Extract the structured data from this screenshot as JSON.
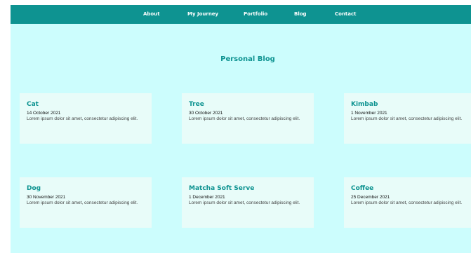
{
  "nav": {
    "items": [
      {
        "label": "About"
      },
      {
        "label": "My Journey"
      },
      {
        "label": "Portfolio"
      },
      {
        "label": "Blog"
      },
      {
        "label": "Contact"
      }
    ]
  },
  "page_title": "Personal Blog",
  "posts": [
    {
      "title": "Cat",
      "date": "14 October 2021",
      "excerpt": "Lorem ipsum dolor sit amet, consectetur adipiscing elit."
    },
    {
      "title": "Tree",
      "date": "30 October 2021",
      "excerpt": "Lorem ipsum dolor sit amet, consectetur adipiscing elit."
    },
    {
      "title": "Kimbab",
      "date": "1 November 2021",
      "excerpt": "Lorem ipsum dolor sit amet, consectetur adipiscing elit."
    },
    {
      "title": "Dog",
      "date": "30 November 2021",
      "excerpt": "Lorem ipsum dolor sit amet, consectetur adipiscing elit."
    },
    {
      "title": "Matcha Soft Serve",
      "date": "1 December 2021",
      "excerpt": "Lorem ipsum dolor sit amet, consectetur adipiscing elit."
    },
    {
      "title": "Coffee",
      "date": "25 December 2021",
      "excerpt": "Lorem ipsum dolor sit amet, consectetur adipiscing elit."
    }
  ],
  "colors": {
    "nav_background": "#0e9391",
    "page_background": "#ccfdfd",
    "card_background": "#e8fcf9",
    "accent": "#0e9391"
  }
}
